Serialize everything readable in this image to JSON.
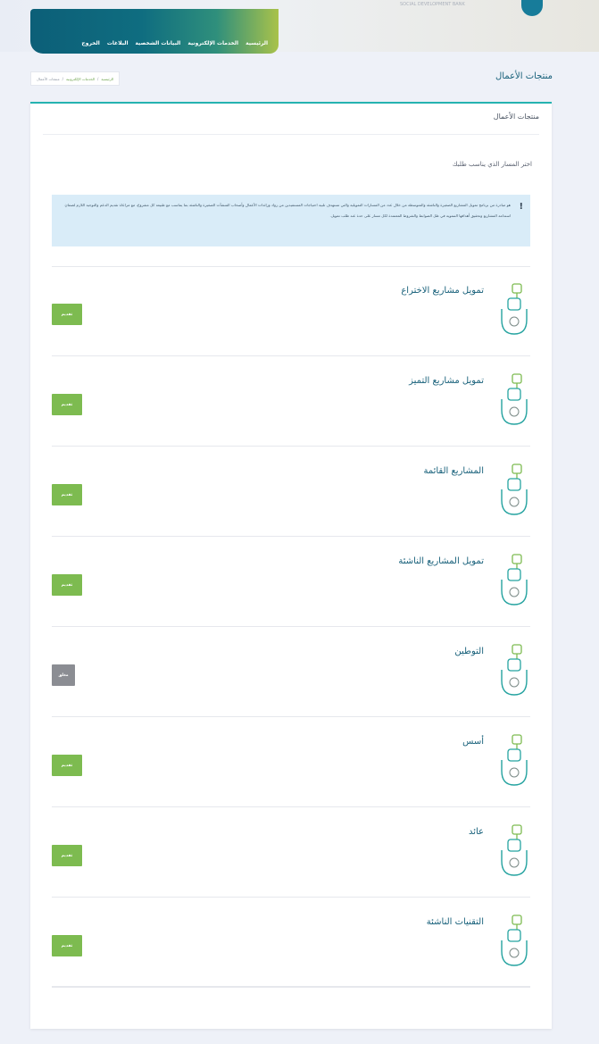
{
  "header": {
    "nav": [
      "الرئيسية",
      "الخدمات الإلكترونية",
      "البيانات الشخصية",
      "البلاغات",
      "الخروج"
    ],
    "user_name": "SOCIAL DEVELOPMENT BANK"
  },
  "page": {
    "title": "منتجات الأعمال",
    "breadcrumb": [
      "الرئيسية",
      "الخدمات الإلكترونية",
      "منتجات الأعمال"
    ]
  },
  "card": {
    "header": "منتجات الأعمال",
    "instruction": "اختر المسار الذي يناسب طلبك",
    "alert_icon": "!",
    "alert_text": "هو مبادرة من برنامج تمويل المشاريع الصغيرة والناشئة والمتوسطة من خلال عدد من المسارات التمويلية والتي تستهدف تلبية احتياجات المستفيدين من رواد ورائدات الأعمال وأصحاب المنشآت الصغيرة والناشئة بما يتناسب مع طبيعة كل مشروع، مع مراعاة تقديم الدعم والتوجيه اللازم لضمان استدامة المشاريع وتحقيق أهدافها التنموية في ظل الضوابط والشروط المعتمدة لكل مسار على حدة عند طلب تمويل."
  },
  "products": [
    {
      "title": "تمويل مشاريع الاختراع",
      "button": "تقديم",
      "enabled": true,
      "icon": "invention-icon"
    },
    {
      "title": "تمويل مشاريع التميز",
      "button": "تقديم",
      "enabled": true,
      "icon": "excellence-star-icon"
    },
    {
      "title": "المشاريع القائمة",
      "button": "تقديم",
      "enabled": true,
      "icon": "existing-projects-icon"
    },
    {
      "title": "تمويل المشاريع الناشئة",
      "button": "تقديم",
      "enabled": true,
      "icon": "startup-hand-icon"
    },
    {
      "title": "التوطين",
      "button": "مغلق",
      "enabled": false,
      "icon": "localization-icon"
    },
    {
      "title": "أسس",
      "button": "تقديم",
      "enabled": true,
      "icon": "foundation-icon"
    },
    {
      "title": "عائد",
      "button": "تقديم",
      "enabled": true,
      "icon": "return-chart-icon"
    },
    {
      "title": "التقنيات الناشئة",
      "button": "تقديم",
      "enabled": true,
      "icon": "emerging-tech-icon"
    }
  ],
  "colors": {
    "primary": "#17607a",
    "accent": "#25b3b0",
    "button": "#7dbb50",
    "button_disabled": "#8b8d93",
    "alert_bg": "#d9ecf8"
  }
}
